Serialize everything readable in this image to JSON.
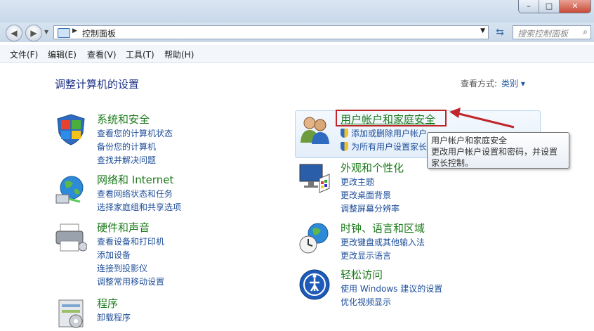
{
  "window": {
    "minimize": "–",
    "maximize": "□",
    "close": "✕"
  },
  "address": {
    "breadcrumb": "控制面板",
    "back": "◀",
    "forward": "▶"
  },
  "search": {
    "placeholder": "搜索控制面板"
  },
  "menu": [
    "文件(F)",
    "编辑(E)",
    "查看(V)",
    "工具(T)",
    "帮助(H)"
  ],
  "page": {
    "heading": "调整计算机的设置",
    "view_label": "查看方式:",
    "view_value": "类别 ▾"
  },
  "categories": [
    {
      "title": "系统和安全",
      "links": [
        "查看您的计算机状态",
        "备份您的计算机",
        "查找并解决问题"
      ],
      "icon": "shield-flag-icon"
    },
    {
      "title": "网络和 Internet",
      "links": [
        "查看网络状态和任务",
        "选择家庭组和共享选项"
      ],
      "icon": "network-globe-icon"
    },
    {
      "title": "硬件和声音",
      "links": [
        "查看设备和打印机",
        "添加设备",
        "连接到投影仪",
        "调整常用移动设置"
      ],
      "icon": "printer-icon"
    },
    {
      "title": "程序",
      "links": [
        "卸载程序"
      ],
      "icon": "programs-icon"
    },
    {
      "title": "用户帐户和家庭安全",
      "links": [
        "添加或删除用户帐户",
        "为所有用户设置家长"
      ],
      "icon": "users-icon"
    },
    {
      "title": "外观和个性化",
      "links": [
        "更改主题",
        "更改桌面背景",
        "调整屏幕分辨率"
      ],
      "icon": "monitor-palette-icon"
    },
    {
      "title": "时钟、语言和区域",
      "links": [
        "更改键盘或其他输入法",
        "更改显示语言"
      ],
      "icon": "clock-globe-icon"
    },
    {
      "title": "轻松访问",
      "links": [
        "使用 Windows 建议的设置",
        "优化视频显示"
      ],
      "icon": "ease-of-access-icon"
    }
  ],
  "tooltip": {
    "line1": "用户帐户和家庭安全",
    "line2": "更改用户帐户设置和密码，并设置家长控制。"
  },
  "colors": {
    "link": "#1f4f9a",
    "category_title": "#1b7a1b",
    "heading": "#1e3287",
    "annotation": "#c0262c"
  }
}
